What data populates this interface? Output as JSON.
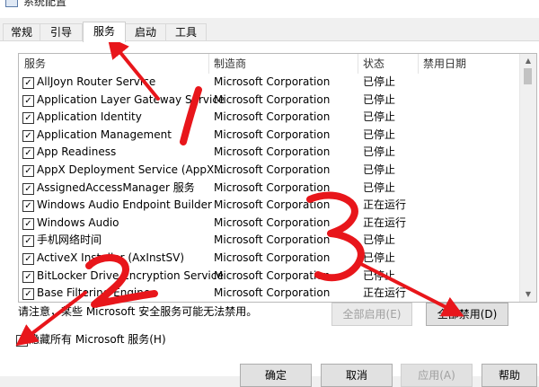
{
  "window": {
    "title": "系统配置"
  },
  "tabs": [
    {
      "label": "常规"
    },
    {
      "label": "引导"
    },
    {
      "label": "服务"
    },
    {
      "label": "启动"
    },
    {
      "label": "工具"
    }
  ],
  "columns": {
    "service": "服务",
    "manufacturer": "制造商",
    "status": "状态",
    "disabled_date": "禁用日期"
  },
  "services": [
    {
      "name": "AllJoyn Router Service",
      "manufacturer": "Microsoft Corporation",
      "status": "已停止",
      "checked": true
    },
    {
      "name": "Application Layer Gateway Service",
      "manufacturer": "Microsoft Corporation",
      "status": "已停止",
      "checked": true
    },
    {
      "name": "Application Identity",
      "manufacturer": "Microsoft Corporation",
      "status": "已停止",
      "checked": true
    },
    {
      "name": "Application Management",
      "manufacturer": "Microsoft Corporation",
      "status": "已停止",
      "checked": true
    },
    {
      "name": "App Readiness",
      "manufacturer": "Microsoft Corporation",
      "status": "已停止",
      "checked": true
    },
    {
      "name": "AppX Deployment Service (AppX...",
      "manufacturer": "Microsoft Corporation",
      "status": "已停止",
      "checked": true
    },
    {
      "name": "AssignedAccessManager 服务",
      "manufacturer": "Microsoft Corporation",
      "status": "已停止",
      "checked": true
    },
    {
      "name": "Windows Audio Endpoint Builder",
      "manufacturer": "Microsoft Corporation",
      "status": "正在运行",
      "checked": true
    },
    {
      "name": "Windows Audio",
      "manufacturer": "Microsoft Corporation",
      "status": "正在运行",
      "checked": true
    },
    {
      "name": "手机网络时间",
      "manufacturer": "Microsoft Corporation",
      "status": "已停止",
      "checked": true
    },
    {
      "name": "ActiveX Installer (AxInstSV)",
      "manufacturer": "Microsoft Corporation",
      "status": "已停止",
      "checked": true
    },
    {
      "name": "BitLocker Drive Encryption Service",
      "manufacturer": "Microsoft Corporation",
      "status": "已停止",
      "checked": true
    },
    {
      "name": "Base Filtering Engine",
      "manufacturer": "Microsoft Corporation",
      "status": "正在运行",
      "checked": true
    }
  ],
  "notice": "请注意，某些 Microsoft 安全服务可能无法禁用。",
  "buttons": {
    "enable_all": "全部启用(E)",
    "disable_all": "全部禁用(D)"
  },
  "hide_ms": {
    "label": "隐藏所有 Microsoft 服务(H)",
    "checked": false
  },
  "footer": {
    "ok": "确定",
    "cancel": "取消",
    "apply": "应用(A)",
    "help": "帮助"
  },
  "annotations": {
    "arrow_color": "#e8161b",
    "marks": [
      "1",
      "2",
      "3"
    ]
  }
}
